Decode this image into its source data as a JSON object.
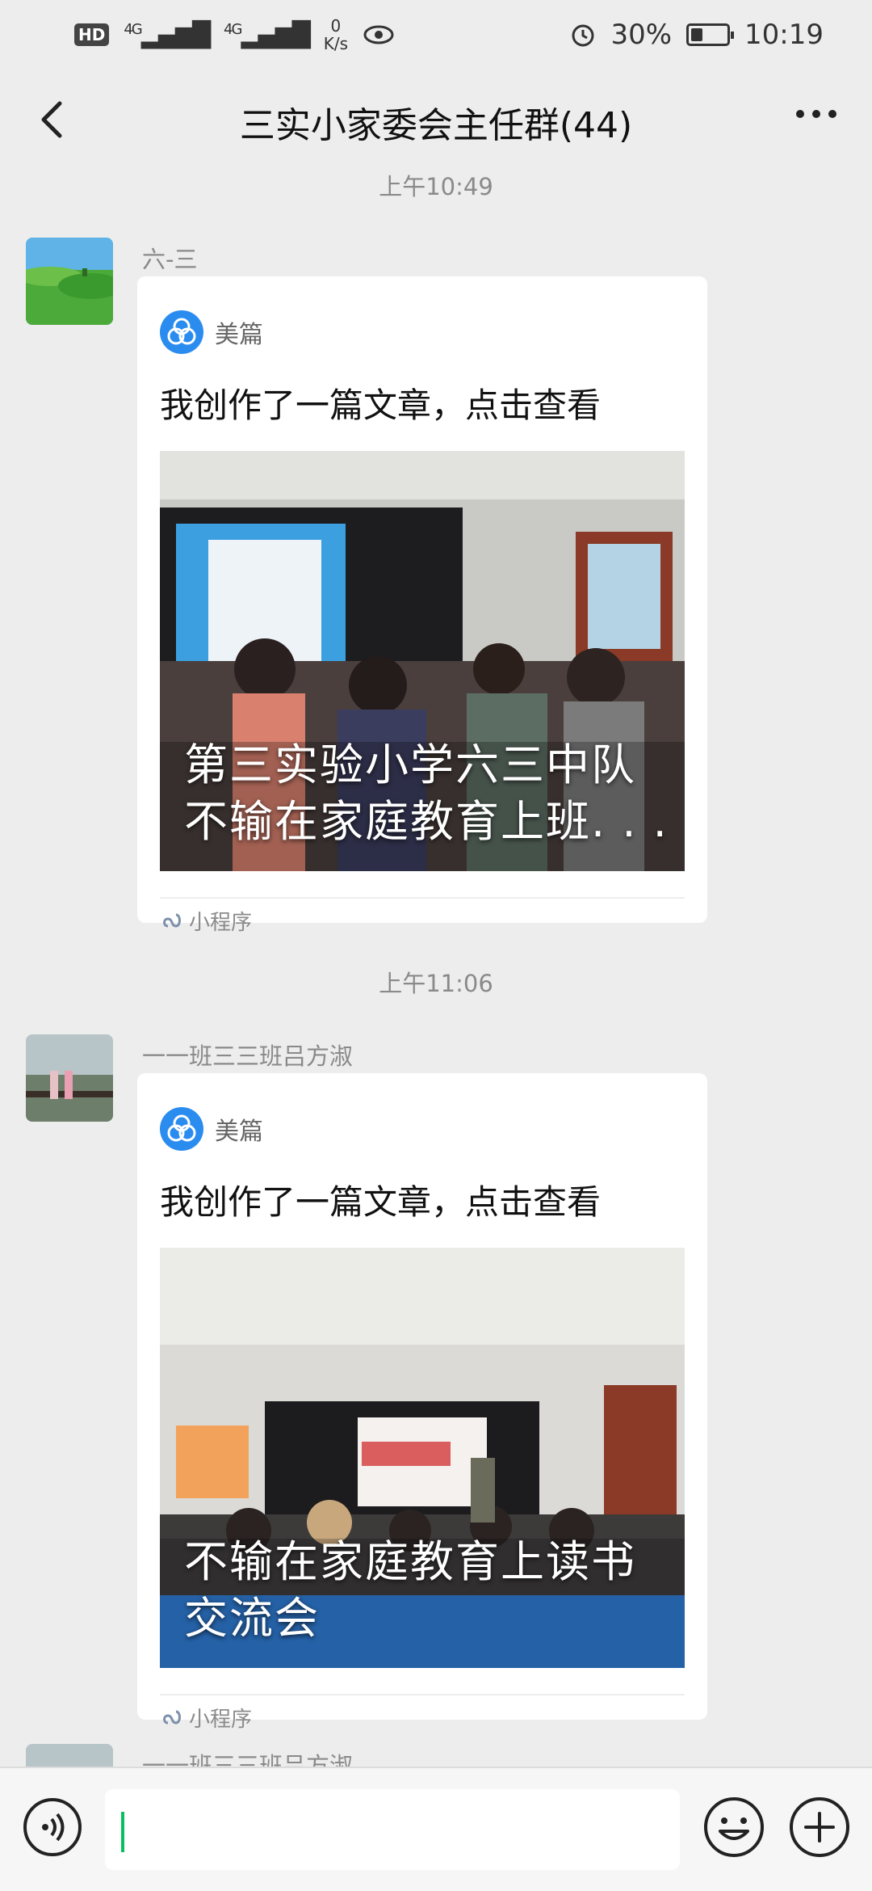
{
  "status_bar": {
    "hd": "HD",
    "sim1": "4G",
    "sim2": "4G",
    "speed_value": "0",
    "speed_unit": "K/s",
    "battery": "30%",
    "battery_level": 0.3,
    "time": "10:19"
  },
  "header": {
    "title": "三实小家委会主任群(44)"
  },
  "chat": {
    "timestamps": [
      "上午10:49",
      "上午11:06"
    ],
    "messages": [
      {
        "sender": "六-三",
        "source": "美篇",
        "title": "我创作了一篇文章，点击查看",
        "caption_line1": "第三实验小学六三中队",
        "caption_line2": "不输在家庭教育上班. . .",
        "footer": "小程序"
      },
      {
        "sender": "一一班三三班吕方淑",
        "source": "美篇",
        "title": "我创作了一篇文章，点击查看",
        "caption_line1": "不输在家庭教育上读书",
        "caption_line2": "交流会",
        "footer": "小程序"
      },
      {
        "sender": "一一班三三班吕方淑"
      }
    ]
  },
  "colors": {
    "background": "#ededed",
    "accent": "#07c160",
    "meipian": "#2b8cf0"
  },
  "icons": [
    "back-icon",
    "more-icon",
    "meipian-logo-icon",
    "mini-program-icon",
    "voice-icon",
    "emoji-icon",
    "plus-icon"
  ]
}
